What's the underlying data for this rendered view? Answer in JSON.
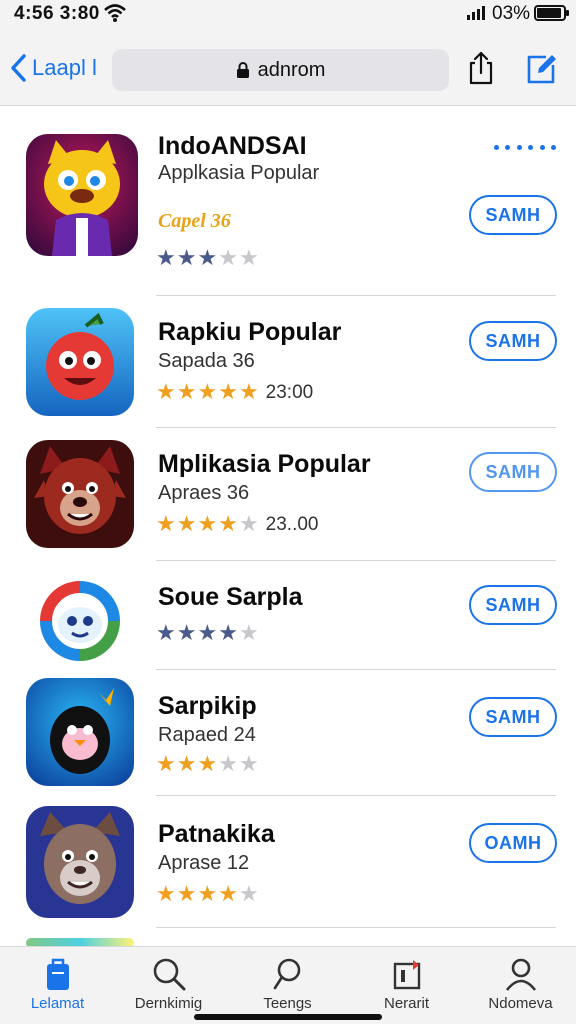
{
  "status_bar": {
    "time": "4:56 3:80",
    "battery_percent": "03%",
    "battery_level": 0.85
  },
  "navbar": {
    "back_label": "Laapl l",
    "url": "adnrom",
    "share_icon": "share-icon",
    "edit_icon": "compose-icon"
  },
  "apps": [
    {
      "name": "IndoANDSAI",
      "subtitle": "Applkasia Popular",
      "price": "Capel 36",
      "rating": 3,
      "rating_count": "",
      "star_color": "#4a5a8a",
      "button": "SAMH",
      "icon": "yellow-cat-character-icon"
    },
    {
      "name": "Rapkiu Popular",
      "subtitle": "Sapada 36",
      "rating": 5,
      "rating_count": "23:00",
      "star_color": "#f0a020",
      "button": "SAMH",
      "icon": "red-ball-character-icon"
    },
    {
      "name": "Mplikasia Popular",
      "subtitle": "Apraes 36",
      "rating": 4,
      "rating_count": "23..00",
      "star_color": "#f0a020",
      "button": "SAMH",
      "icon": "red-wolf-character-icon"
    },
    {
      "name": "Soue Sarpla",
      "subtitle": "",
      "rating": 4,
      "rating_count": "",
      "star_color": "#4a5a8a",
      "button": "SAMH",
      "icon": "colorful-bird-logo-icon"
    },
    {
      "name": "Sarpikip",
      "subtitle": "Rapaed 24",
      "rating": 3,
      "rating_count": "",
      "star_color": "#f0a020",
      "button": "SAMH",
      "icon": "penguin-character-icon"
    },
    {
      "name": "Patnakika",
      "subtitle": "Aprase 12",
      "rating": 4,
      "rating_count": "",
      "star_color": "#f0a020",
      "button": "OAMH",
      "icon": "wolf-face-character-icon"
    }
  ],
  "tabs": [
    {
      "label": "Lelamat",
      "icon": "today-icon",
      "active": true
    },
    {
      "label": "Dernkimig",
      "icon": "search-icon",
      "active": false
    },
    {
      "label": "Teengs",
      "icon": "games-icon",
      "active": false
    },
    {
      "label": "Nerarit",
      "icon": "apps-icon",
      "active": false
    },
    {
      "label": "Ndomeva",
      "icon": "profile-icon",
      "active": false
    }
  ],
  "colors": {
    "accent": "#1a73e8",
    "star_gold": "#f0a020",
    "star_navy": "#4a5a8a",
    "star_empty": "#c8c8cc",
    "price": "#e8a317"
  }
}
